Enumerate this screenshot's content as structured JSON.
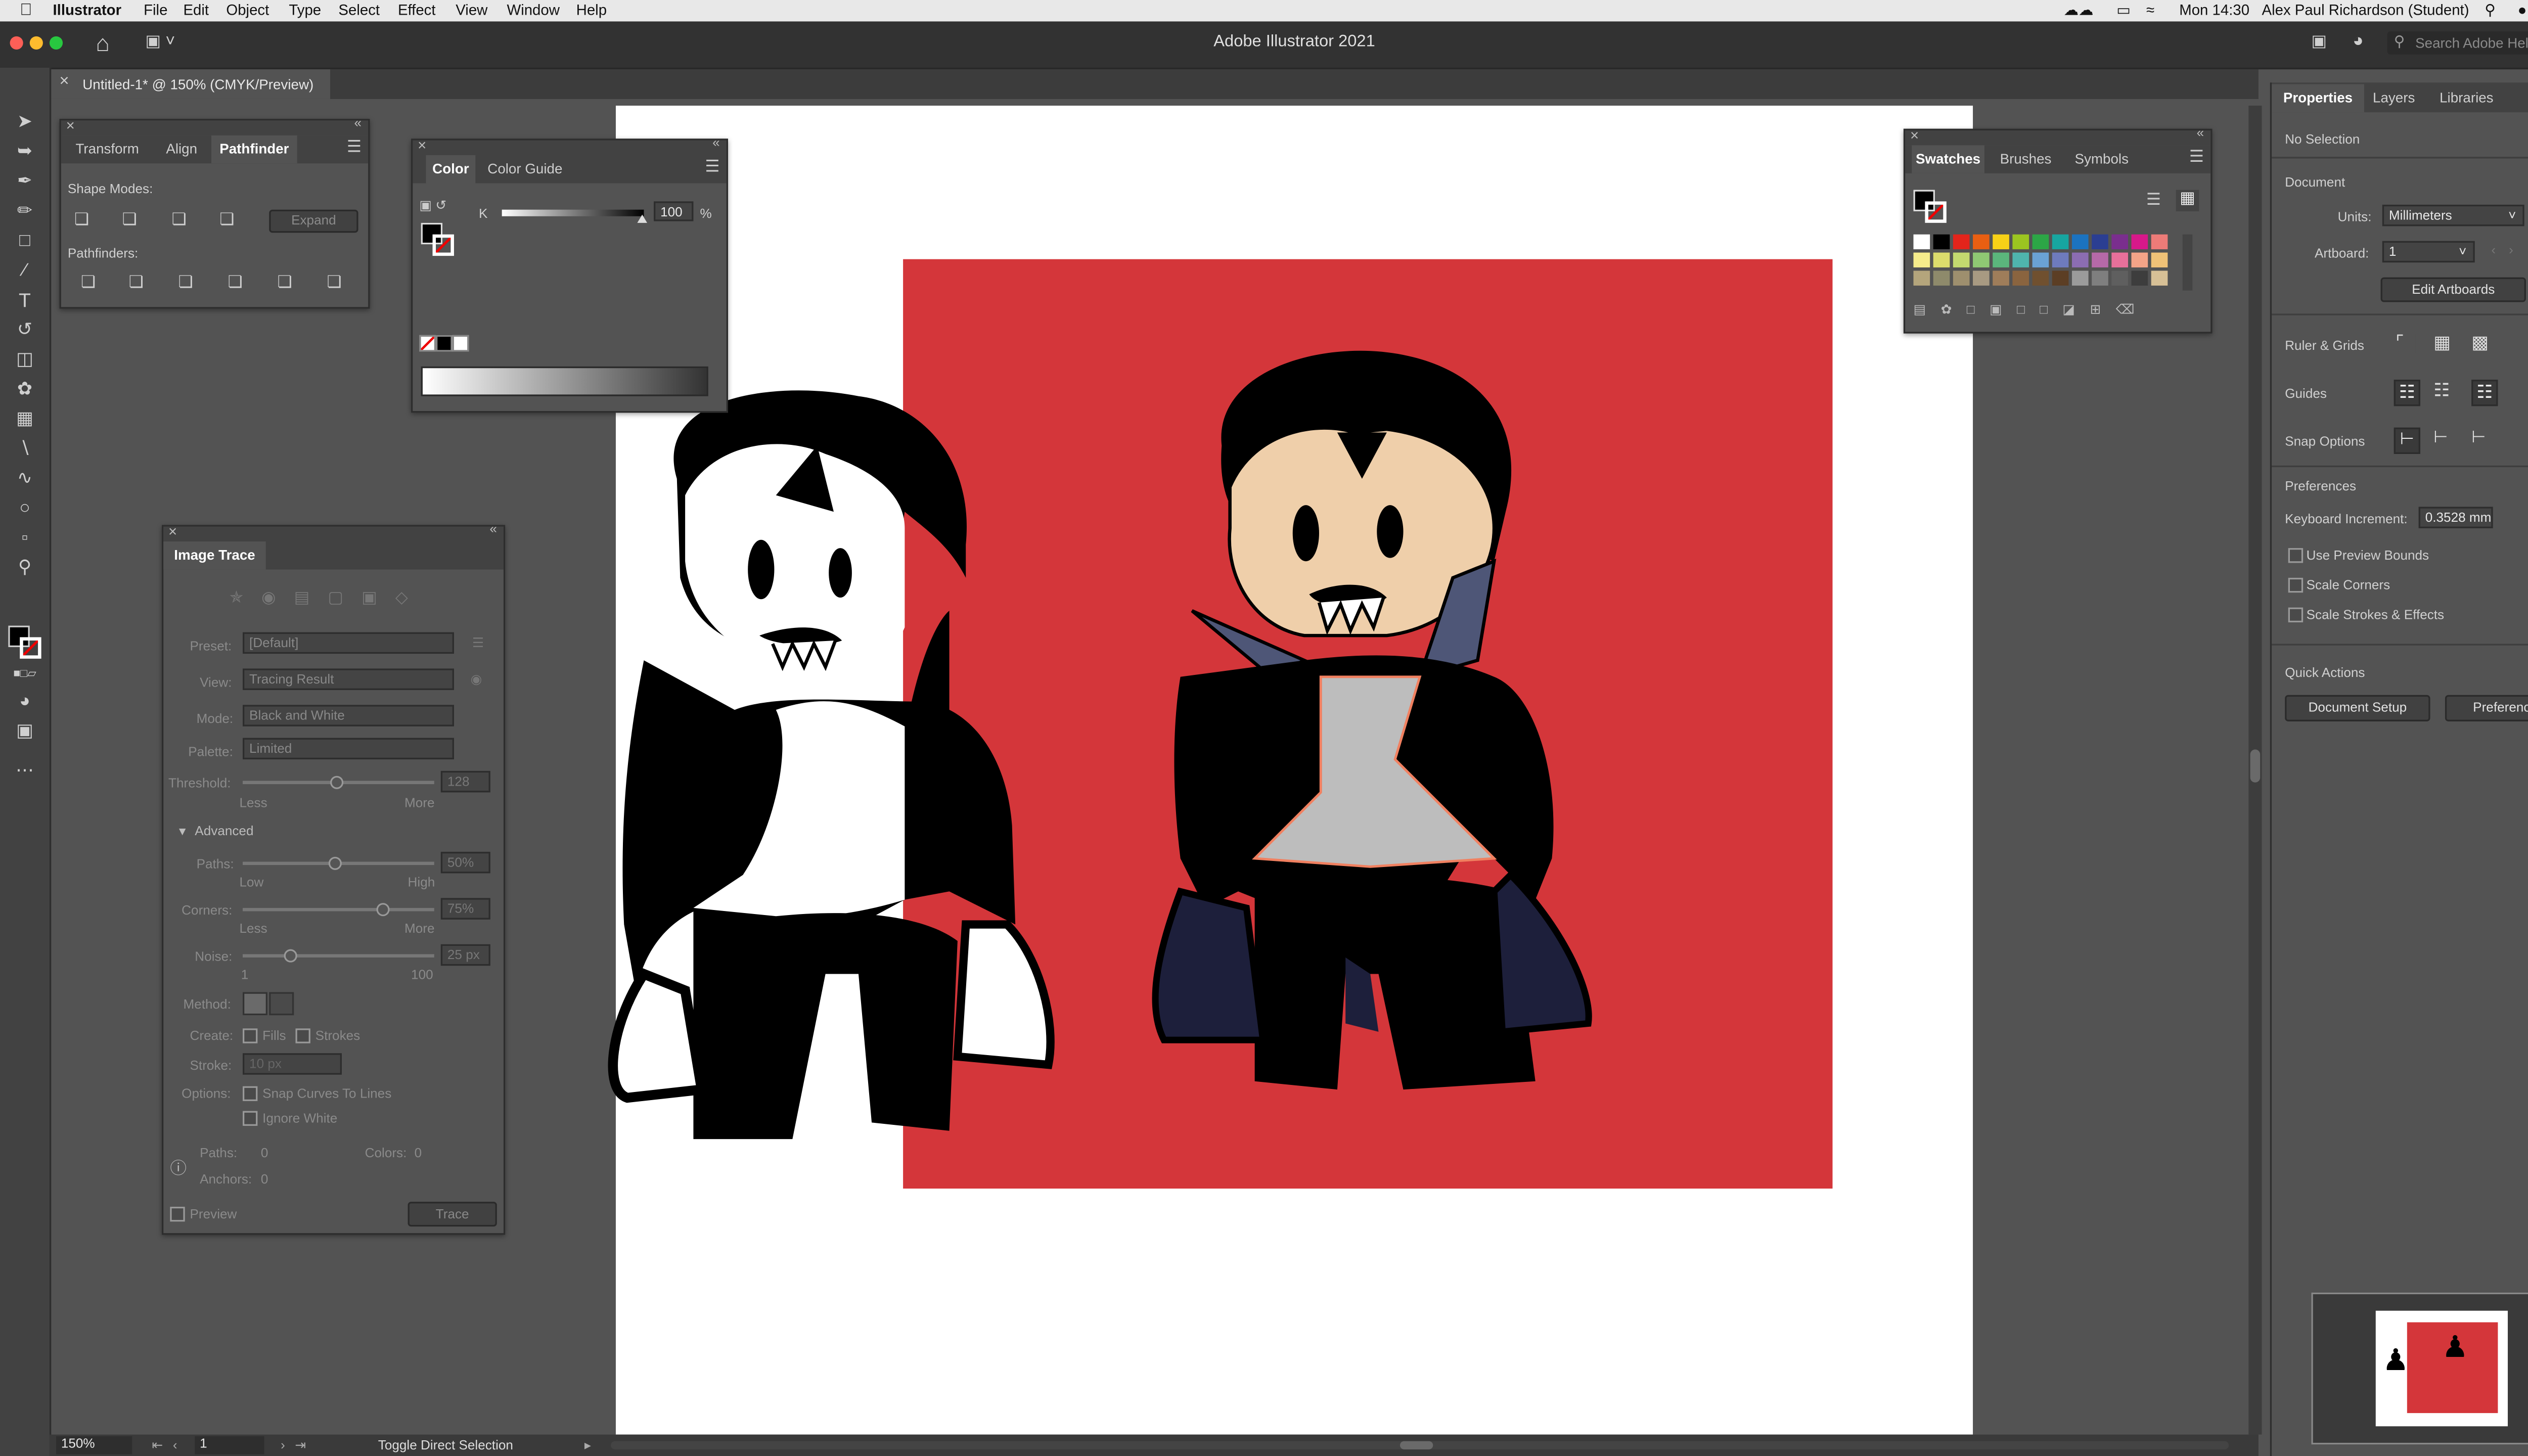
{
  "menubar": {
    "apple": "",
    "items": [
      "Illustrator",
      "File",
      "Edit",
      "Object",
      "Type",
      "Select",
      "Effect",
      "View",
      "Window",
      "Help"
    ],
    "clock": "Mon 14:30",
    "user": "Alex Paul Richardson (Student)"
  },
  "app": {
    "title": "Adobe Illustrator 2021",
    "search_placeholder": "Search Adobe Help"
  },
  "doc_tab": {
    "label": "Untitled-1* @ 150% (CMYK/Preview)",
    "close": "×"
  },
  "pathfinder": {
    "tabs": [
      "Transform",
      "Align",
      "Pathfinder"
    ],
    "shape_modes": "Shape Modes:",
    "expand": "Expand",
    "pathfinders": "Pathfinders:"
  },
  "color": {
    "tabs": [
      "Color",
      "Color Guide"
    ],
    "channel": "K",
    "value": "100",
    "unit": "%"
  },
  "swatches": {
    "tabs": [
      "Swatches",
      "Brushes",
      "Symbols"
    ],
    "colors": [
      [
        "#ffffff",
        "#000000",
        "#e3241b",
        "#e95f12",
        "#f7d117",
        "#9bc520",
        "#2ca646",
        "#17a6a0",
        "#1b73c0",
        "#2b3e92",
        "#7a2e8e",
        "#d7188a",
        "#ed7b78"
      ],
      [
        "#f6ec8b",
        "#dcdc6c",
        "#c3d96f",
        "#8fc873",
        "#5bb67c",
        "#4fb4ad",
        "#6aa2d5",
        "#6e7bbd",
        "#8b6db2",
        "#b669a8",
        "#e7709a",
        "#f4a488",
        "#f0c277"
      ],
      [
        "#b4a57c",
        "#8e8a6b",
        "#9e8f6e",
        "#a89a82",
        "#9f7d5a",
        "#8a643f",
        "#70502f",
        "#5c3e24",
        "#9b9b9b",
        "#7f7f7f",
        "#5f5f5f",
        "#3d3d3d",
        "#d7c096"
      ]
    ]
  },
  "image_trace": {
    "title": "Image Trace",
    "preset_label": "Preset:",
    "preset": "[Default]",
    "view_label": "View:",
    "view": "Tracing Result",
    "mode_label": "Mode:",
    "mode": "Black and White",
    "palette_label": "Palette:",
    "palette": "Limited",
    "threshold_label": "Threshold:",
    "threshold_val": "128",
    "less": "Less",
    "more": "More",
    "advanced": "Advanced",
    "paths_label": "Paths:",
    "paths_val": "50%",
    "low": "Low",
    "high": "High",
    "corners_label": "Corners:",
    "corners_val": "75%",
    "noise_label": "Noise:",
    "noise_val": "25 px",
    "noise_min": "1",
    "noise_max": "100",
    "method_label": "Method:",
    "create_label": "Create:",
    "fills": "Fills",
    "strokes": "Strokes",
    "stroke_label": "Stroke:",
    "stroke_val": "10 px",
    "options_label": "Options:",
    "snap": "Snap Curves To Lines",
    "ignore_white": "Ignore White",
    "paths_stat": "Paths:",
    "paths_stat_val": "0",
    "colors_stat": "Colors:",
    "colors_stat_val": "0",
    "anchors_stat": "Anchors:",
    "anchors_stat_val": "0",
    "preview": "Preview",
    "trace": "Trace"
  },
  "properties": {
    "tabs": [
      "Properties",
      "Layers",
      "Libraries"
    ],
    "no_selection": "No Selection",
    "document": "Document",
    "units_label": "Units:",
    "units": "Millimeters",
    "artboard_label": "Artboard:",
    "artboard": "1",
    "edit_artboards": "Edit Artboards",
    "ruler_grids": "Ruler & Grids",
    "guides": "Guides",
    "snap_options": "Snap Options",
    "preferences_head": "Preferences",
    "keyboard_increment_label": "Keyboard Increment:",
    "keyboard_increment": "0.3528 mm",
    "use_preview_bounds": "Use Preview Bounds",
    "scale_corners": "Scale Corners",
    "scale_strokes": "Scale Strokes & Effects",
    "quick_actions": "Quick Actions",
    "document_setup": "Document Setup",
    "preferences": "Preferences"
  },
  "status": {
    "zoom": "150%",
    "artboard": "1",
    "tool": "Toggle Direct Selection"
  },
  "colors": {
    "canvas_red": "#d4363a",
    "skin": "#efcfaa",
    "cape": "#1d1f3b",
    "collar": "#4e5677",
    "shirt": "#bdbdbd"
  }
}
